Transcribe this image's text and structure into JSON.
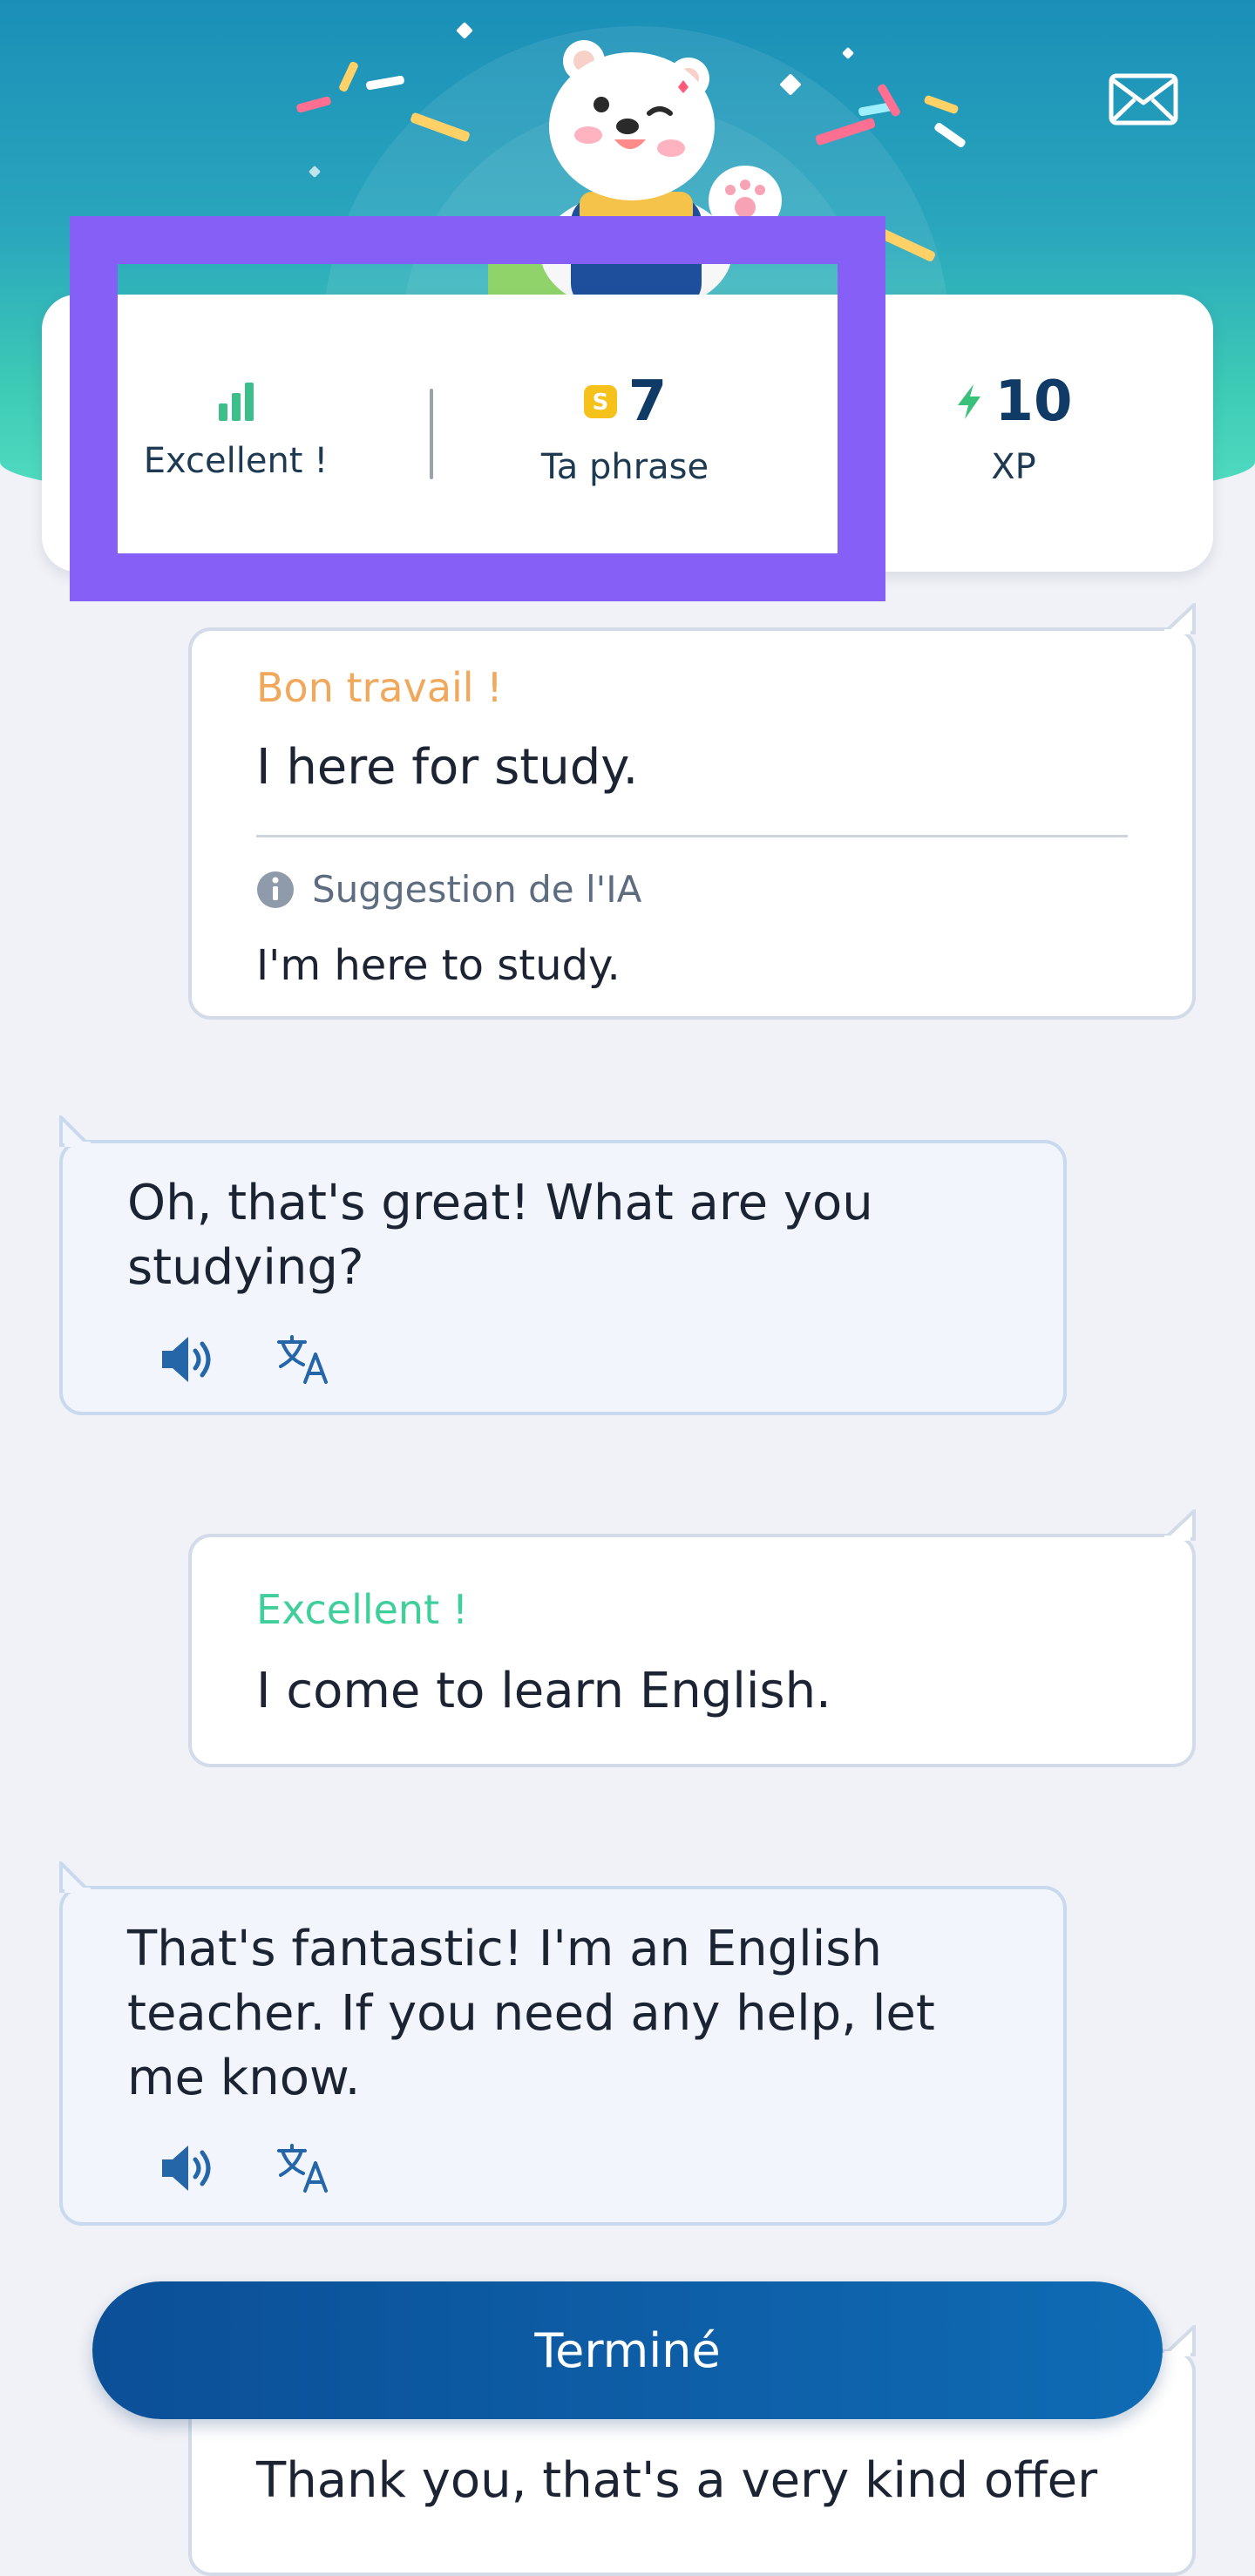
{
  "header": {
    "mail_icon": "mail-icon"
  },
  "stats": {
    "rating_label": "Excellent !",
    "sentence_count": "7",
    "sentence_label": "Ta phrase",
    "xp_value": "10",
    "xp_label": "XP"
  },
  "messages": [
    {
      "role": "user",
      "feedback": "Bon travail !",
      "feedback_color": "#f0a85c",
      "text": "I here for study.",
      "suggestion_label": "Suggestion de l'IA",
      "suggestion": "I'm here to study."
    },
    {
      "role": "ai",
      "text": "Oh, that's great! What are you studying?"
    },
    {
      "role": "user",
      "feedback": "Excellent !",
      "feedback_color": "#3fcf9a",
      "text": "I come to learn English."
    },
    {
      "role": "ai",
      "text": "That's fantastic! I'm an English teacher. If you need any help, let me know."
    },
    {
      "role": "user",
      "text": "Thank you, that's a very kind offer"
    }
  ],
  "footer": {
    "done_label": "Terminé"
  },
  "colors": {
    "accent": "#0f6bb4",
    "highlight": "#855ff6",
    "success": "#3fcf9a",
    "warning": "#f0a85c"
  }
}
